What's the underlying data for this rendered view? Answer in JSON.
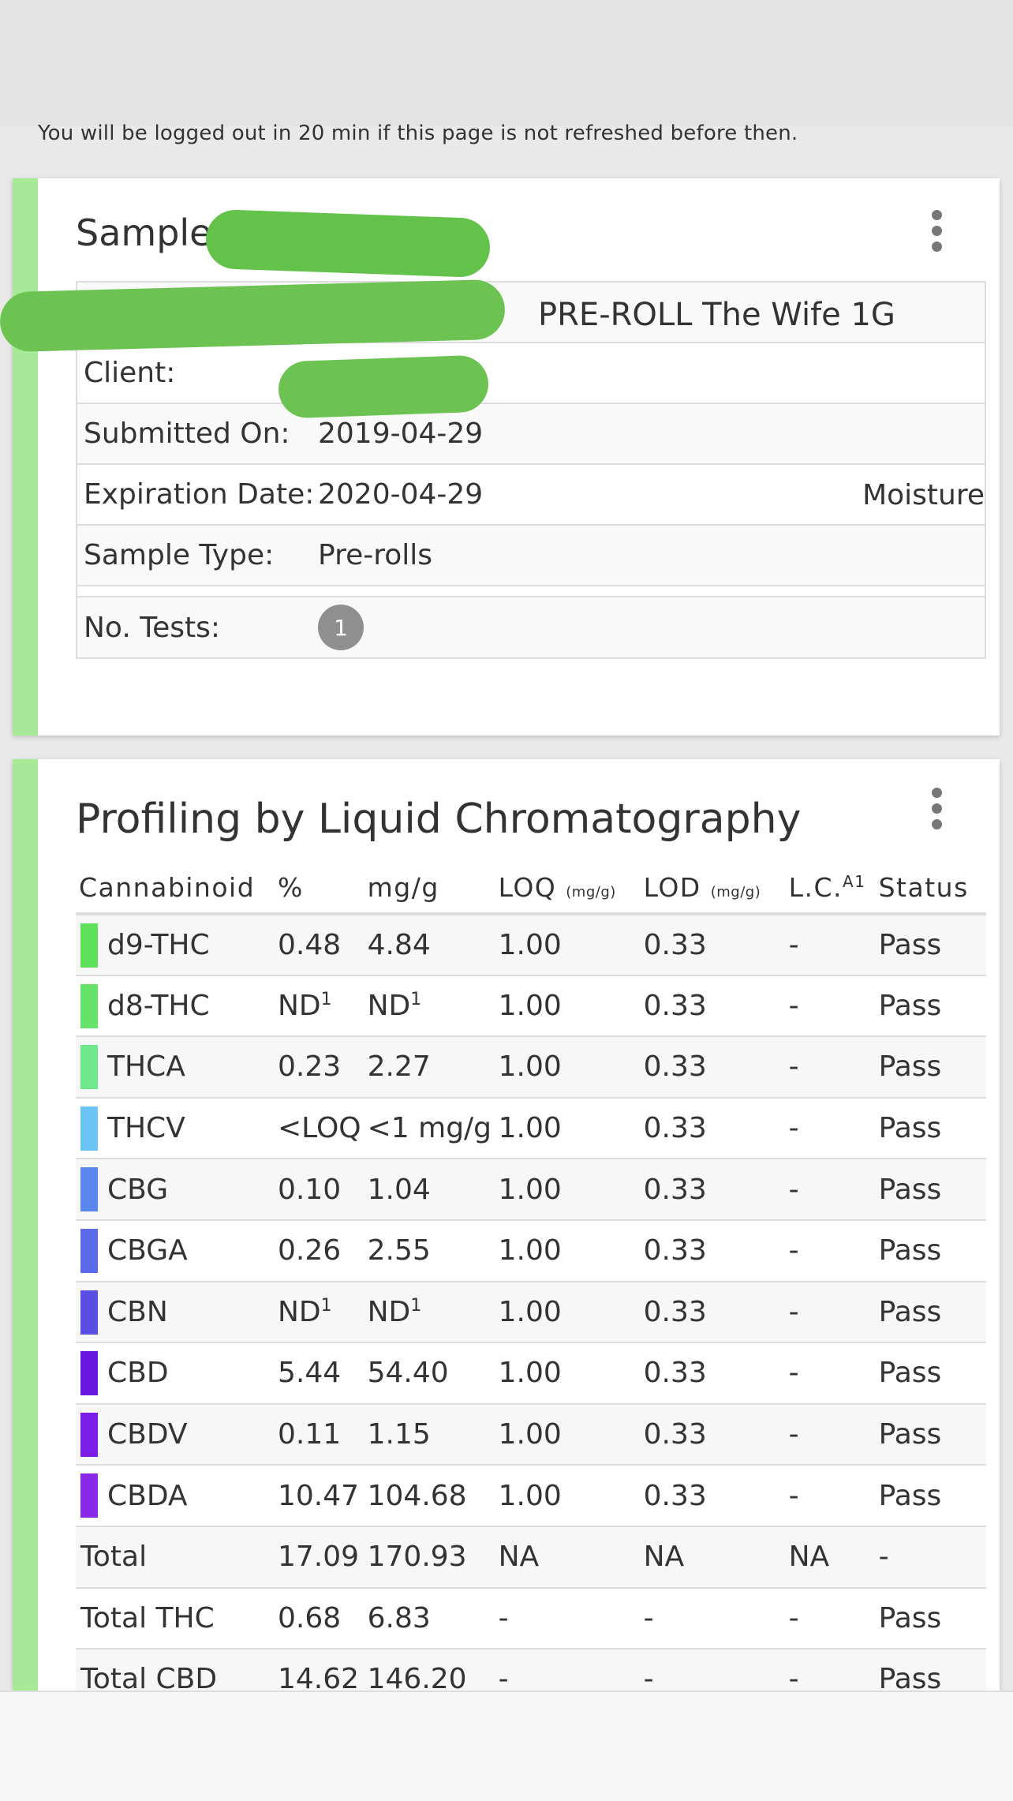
{
  "notice": "You will be logged out in 20 min if this page is not refreshed before then.",
  "sample_card": {
    "title": "Sample",
    "name_value": "PRE-ROLL The Wife 1G",
    "rows": [
      {
        "label": "Client:",
        "value": ""
      },
      {
        "label": "Submitted On:",
        "value": "2019-04-29"
      },
      {
        "label": "Expiration Date:",
        "value": "2020-04-29",
        "extra": "Moisture"
      },
      {
        "label": "Sample Type:",
        "value": "Pre-rolls"
      },
      {
        "label": "No. Tests:",
        "badge": "1"
      }
    ]
  },
  "lc_card": {
    "title": "Profiling by Liquid Chromatography",
    "headers": {
      "cannabinoid": "Cannabinoid",
      "percent": "%",
      "mg": "mg/g",
      "loq": "LOQ",
      "loq_unit": "(mg/g)",
      "lod": "LOD",
      "lod_unit": "(mg/g)",
      "lc": "L.C.",
      "lc_sup": "A1",
      "status": "Status"
    },
    "footnote_mark": "1",
    "rows": [
      {
        "name": "d9-THC",
        "color": "#5ee05a",
        "pct": "0.48",
        "mg": "4.84",
        "loq": "1.00",
        "lod": "0.33",
        "lc": "-",
        "status": "Pass"
      },
      {
        "name": "d8-THC",
        "color": "#66e36a",
        "pct": "ND",
        "pct_sup": "1",
        "mg": "ND",
        "mg_sup": "1",
        "loq": "1.00",
        "lod": "0.33",
        "lc": "-",
        "status": "Pass"
      },
      {
        "name": "THCA",
        "color": "#6ee88a",
        "pct": "0.23",
        "mg": "2.27",
        "loq": "1.00",
        "lod": "0.33",
        "lc": "-",
        "status": "Pass"
      },
      {
        "name": "THCV",
        "color": "#6ec3f5",
        "pct": "<LOQ",
        "mg": "<1 mg/g",
        "loq": "1.00",
        "lod": "0.33",
        "lc": "-",
        "status": "Pass"
      },
      {
        "name": "CBG",
        "color": "#5b86ee",
        "pct": "0.10",
        "mg": "1.04",
        "loq": "1.00",
        "lod": "0.33",
        "lc": "-",
        "status": "Pass"
      },
      {
        "name": "CBGA",
        "color": "#5a6ae8",
        "pct": "0.26",
        "mg": "2.55",
        "loq": "1.00",
        "lod": "0.33",
        "lc": "-",
        "status": "Pass"
      },
      {
        "name": "CBN",
        "color": "#5a4fe4",
        "pct": "ND",
        "pct_sup": "1",
        "mg": "ND",
        "mg_sup": "1",
        "loq": "1.00",
        "lod": "0.33",
        "lc": "-",
        "status": "Pass"
      },
      {
        "name": "CBD",
        "color": "#6a18e0",
        "pct": "5.44",
        "mg": "54.40",
        "loq": "1.00",
        "lod": "0.33",
        "lc": "-",
        "status": "Pass"
      },
      {
        "name": "CBDV",
        "color": "#7a1ee8",
        "pct": "0.11",
        "mg": "1.15",
        "loq": "1.00",
        "lod": "0.33",
        "lc": "-",
        "status": "Pass"
      },
      {
        "name": "CBDA",
        "color": "#8a2ae8",
        "pct": "10.47",
        "mg": "104.68",
        "loq": "1.00",
        "lod": "0.33",
        "lc": "-",
        "status": "Pass"
      },
      {
        "name": "Total",
        "pct": "17.09",
        "mg": "170.93",
        "loq": "NA",
        "lod": "NA",
        "lc": "NA",
        "status": "-"
      },
      {
        "name": "Total THC",
        "pct": "0.68",
        "mg": "6.83",
        "loq": "-",
        "lod": "-",
        "lc": "-",
        "status": "Pass"
      },
      {
        "name": "Total CBD",
        "pct": "14.62",
        "mg": "146.20",
        "loq": "-",
        "lod": "-",
        "lc": "-",
        "status": "Pass"
      }
    ]
  }
}
